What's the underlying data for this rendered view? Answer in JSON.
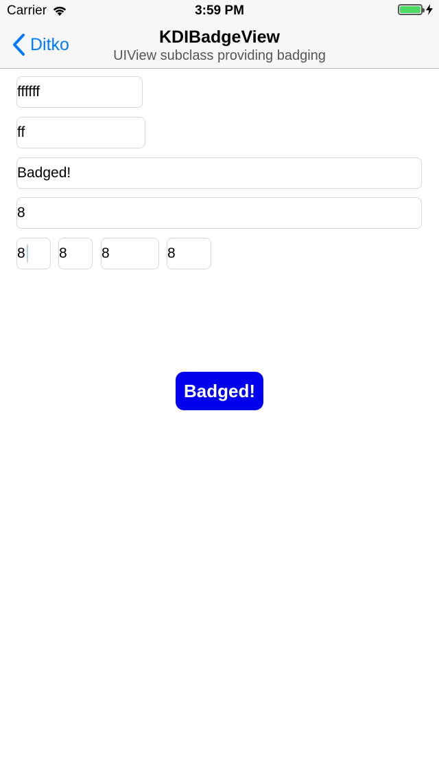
{
  "status_bar": {
    "carrier": "Carrier",
    "time": "3:59 PM",
    "battery_color": "#4cd964"
  },
  "nav": {
    "back_label": "Ditko",
    "title": "KDIBadgeView",
    "subtitle": "UIView subclass providing badging",
    "accent": "#007aff"
  },
  "fields": {
    "text_color": "ffffff",
    "background_color": "ff",
    "badge_text": "Badged!",
    "corner_radius": "8",
    "insets": {
      "top": "8",
      "left": "8",
      "bottom": "8",
      "right": "8"
    }
  },
  "badge": {
    "label": "Badged!",
    "color": "#0000ee"
  }
}
